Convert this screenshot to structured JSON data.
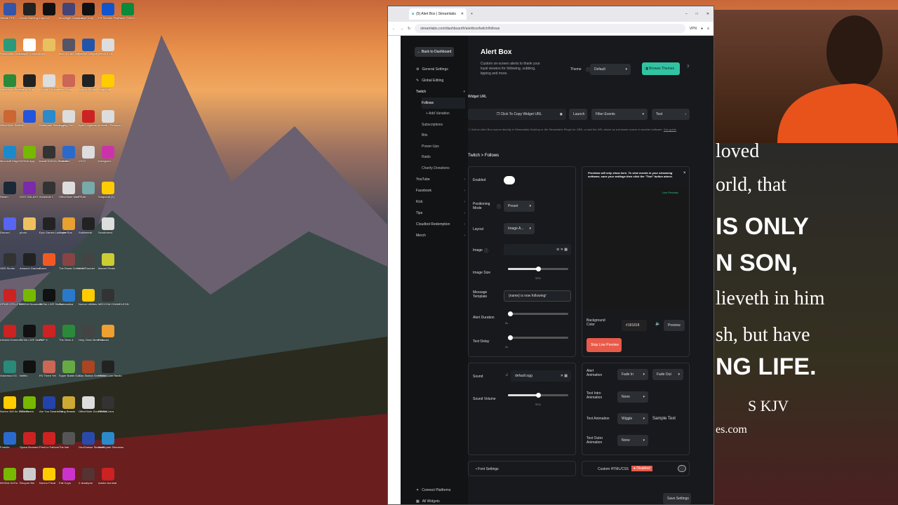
{
  "desktop": {
    "icons": [
      [
        "Official PDF",
        "#3355aa"
      ],
      [
        "Ghost Gaming",
        "#222"
      ],
      [
        "CapCut",
        "#111"
      ],
      [
        "Moonlight Gameplay",
        "#447"
      ],
      [
        "Call of Duty",
        "#111"
      ],
      [
        "PS Remote Play",
        "#1155cc"
      ],
      [
        "Razer Cortex",
        "#0a8a3a"
      ],
      [
        "Streamlabs Desktop",
        "#2a9a7a"
      ],
      [
        "Ubisoft Connect",
        "#fff"
      ],
      [
        "clips",
        "#e8c060"
      ],
      [
        "Man of Law Judge",
        "#556"
      ],
      [
        "Rocket League",
        "#2255aa"
      ],
      [
        "Jetton 3-16",
        "#ddd"
      ],
      [
        "OfficeSuite Sheets",
        "#2a8a3a"
      ],
      [
        "Call of Duty",
        "#222"
      ],
      [
        "Google Chrome",
        "#ddd"
      ],
      [
        "Rec Room",
        "#c65"
      ],
      [
        "Roblox Studio",
        "#222"
      ],
      [
        "Snapchat",
        "#fc0"
      ],
      [
        "OfficeSuite Slides",
        "#c63"
      ],
      [
        "EA",
        "#2255dd"
      ],
      [
        "Waterpark Simulator",
        "#2a8acc"
      ],
      [
        "Egging On",
        "#ddd"
      ],
      [
        "Apex Legends",
        "#c22"
      ],
      [
        "erbezie - Persona",
        "#ddd"
      ],
      [
        "Microsoft Edge",
        "#1a8acc"
      ],
      [
        "NVIDIA App",
        "#76b900"
      ],
      [
        "Install NVIDIA Controller",
        "#333"
      ],
      [
        "Fortnite",
        "#2a6acc"
      ],
      [
        "VICO",
        "#ddd"
      ],
      [
        "Instagram",
        "#c3a"
      ],
      [
        "Steam",
        "#1b2838"
      ],
      [
        "GOG GALAXY",
        "#7a2aaa"
      ],
      [
        "Schedule I",
        "#333"
      ],
      [
        "OfficeSuite Mail",
        "#ddd"
      ],
      [
        "PEAK",
        "#7aa"
      ],
      [
        "Snapchat (1)",
        "#fc0"
      ],
      [
        "Discord",
        "#5865f2"
      ],
      [
        "photo",
        "#eec060"
      ],
      [
        "Epic Games Launcher",
        "#222"
      ],
      [
        "Super Sus",
        "#e8a030"
      ],
      [
        "Sublimeral",
        "#222"
      ],
      [
        "Scrutinized",
        "#ddd"
      ],
      [
        "OBS Studio",
        "#333"
      ],
      [
        "Amazon Games",
        "#222"
      ],
      [
        "Brave",
        "#f05a22"
      ],
      [
        "The Roast Coffee Sh",
        "#844"
      ],
      [
        "War Thunder",
        "#444"
      ],
      [
        "Marvel Rivals",
        "#cc3"
      ],
      [
        "CPUID CPU-Z MSI",
        "#c22"
      ],
      [
        "NVIDIA Broadcast",
        "#76b900"
      ],
      [
        "TikTok LIVE Studio",
        "#111"
      ],
      [
        "Subnautica",
        "#2a7acc"
      ],
      [
        "Norton Utilities",
        "#fc0"
      ],
      [
        "MECCHA CHAMELEON",
        "#333"
      ],
      [
        "AIDA64 Extreme",
        "#c22"
      ],
      [
        "TikTok LIVE Studio",
        "#111"
      ],
      [
        "PDF X",
        "#c22"
      ],
      [
        "The Sims 4",
        "#2a8a3a"
      ],
      [
        "Only Climb Better To",
        "#444"
      ],
      [
        "Palworld",
        "#eea030"
      ],
      [
        "Voicemod V3",
        "#2a8a7a"
      ],
      [
        "Netflix",
        "#111"
      ],
      [
        "RV There Yet",
        "#c65"
      ],
      [
        "Super Battle Golf",
        "#6a4"
      ],
      [
        "Gas Station Simulator",
        "#a42"
      ],
      [
        "PRISM Live Studio",
        "#222"
      ],
      [
        "Norton 360 for Gamers",
        "#fc0"
      ],
      [
        "RTX Remix",
        "#76b900"
      ],
      [
        "Are You Smarter th",
        "#2244aa"
      ],
      [
        "Gang Beasts",
        "#ca3"
      ],
      [
        "OfficeSuite Documents",
        "#ddd"
      ],
      [
        "PRISM Lens",
        "#333"
      ],
      [
        "Fortnite",
        "#2a6acc"
      ],
      [
        "Opera Browser",
        "#c22"
      ],
      [
        "Feed to Fathom",
        "#c22"
      ],
      [
        "The Isle",
        "#555"
      ],
      [
        "GeoGuessr Steam E",
        "#2a4aaa"
      ],
      [
        "Waterpark Simulator",
        "#2a8acc"
      ],
      [
        "NVIDIA GeFor",
        "#76b900"
      ],
      [
        "Recycle Bin",
        "#ccc"
      ],
      [
        "Norton Privat",
        "#fc0"
      ],
      [
        "Fall Guys",
        "#c3c"
      ],
      [
        "2 deadlyvis",
        "#533"
      ],
      [
        "Adobe Acrobat",
        "#c22"
      ]
    ]
  },
  "browser": {
    "tab_title": "(5) Alert Box | Streamlabs",
    "url": "streamlabs.com/dashboard#/alertbox/twitch/follows",
    "vpn": "VPN"
  },
  "sidenav": {
    "back": "Back to Dashboard",
    "general": "General Settings",
    "global": "Global Editing",
    "twitch": "Twitch",
    "twitch_items": [
      "Follows",
      "+ Add Variation",
      "Subscriptions",
      "Bits",
      "Power-Ups",
      "Raids",
      "Charity Donations"
    ],
    "platforms": [
      "YouTube",
      "Facebook",
      "Kick"
    ],
    "extras": [
      "Tips",
      "Cloudbot Redemption",
      "Merch"
    ],
    "connect": "Connect Platforms",
    "all_widgets": "All Widgets"
  },
  "main": {
    "title": "Alert Box",
    "description": "Custom on-screen alerts to thank your loyal viewers for following, subbing, tipping and more.",
    "theme_label": "Theme",
    "theme_value": "Default",
    "browse_themes": "Browse Themes",
    "widget_url_label": "Widget URL",
    "copy_url": "Click To Copy Widget URL",
    "launch": "Launch",
    "filter_events": "Filter Events",
    "test": "Test",
    "source_note": "Add an Alert Box source directly in Streamlabs Desktop or the Streamlabs Plugin for OBS, or add the URL above as a browser source in another software.",
    "see_guide": "See guide",
    "breadcrumb": "Twitch > Follows",
    "enabled": "Enabled",
    "positioning_mode": "Positioning Mode",
    "positioning_value": "Preset",
    "layout": "Layout",
    "layout_value": "Image A...",
    "image": "Image",
    "image_size": "Image Size",
    "image_size_value": "50%",
    "message_template": "Message Template",
    "message_value": "{name} is now following!",
    "alert_duration": "Alert Duration",
    "alert_duration_value": "8s",
    "text_delay": "Text Delay",
    "text_delay_value": "0s",
    "preview_note": "Previews will only show here. To view events in your streaming software, save your settings then click the \"Test\" button above.",
    "live_preview": "Live Preview",
    "bg_color": "Background Color",
    "bg_color_value": "#181818",
    "preview_btn": "Preview",
    "stop_preview": "Stop Live Preview",
    "sound": "Sound",
    "sound_value": "default.ogg",
    "sound_volume": "Sound Volume",
    "sound_volume_value": "50%",
    "alert_animation": "Alert Animation",
    "fade_in": "Fade In",
    "fade_out": "Fade Out",
    "text_intro": "Text Intro Animation",
    "text_intro_value": "None",
    "text_animation": "Text Animation",
    "text_animation_value": "Wiggle",
    "sample_text": "Sample Text",
    "text_outro": "Text Outro Animation",
    "text_outro_value": "None",
    "font_settings": "Font Settings",
    "custom_css": "Custom HTML/CSS",
    "disabled": "Disabled",
    "save": "Save Settings"
  },
  "overlay": {
    "verse_lines": [
      "loved",
      "orld, that",
      "IS ONLY",
      "N SON,",
      "lieveth in him",
      "sh, but have",
      "NG LIFE.",
      "S KJV",
      "es.com"
    ]
  }
}
